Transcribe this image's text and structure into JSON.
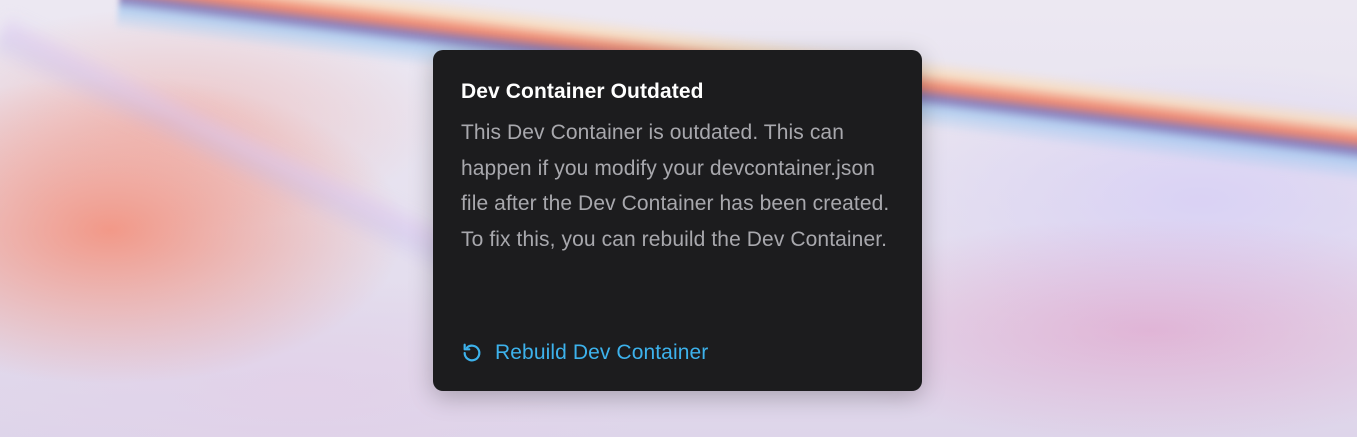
{
  "notification": {
    "title": "Dev Container Outdated",
    "description": "This Dev Container is outdated. This can happen if you modify your devcontainer.json file after the Dev Container has been created. To fix this, you can rebuild the Dev Container.",
    "action": {
      "label": "Rebuild Dev Container",
      "icon": "rotate-ccw-icon"
    }
  },
  "colors": {
    "card_background": "#1c1c1e",
    "title": "#ffffff",
    "description": "#a8a8ad",
    "accent": "#3db2ec"
  }
}
